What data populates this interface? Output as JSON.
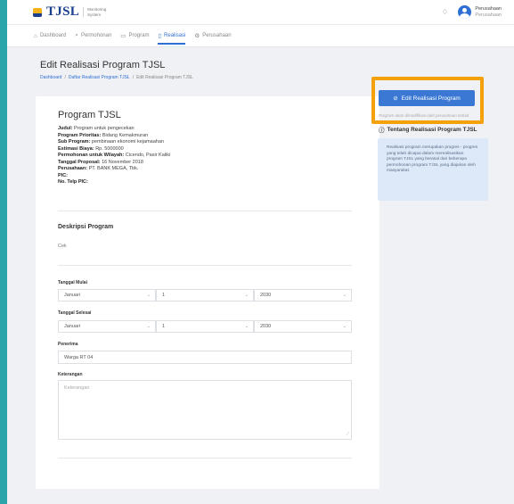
{
  "header": {
    "brand_name": "TJSL",
    "brand_sub": "Monitoring System",
    "user_name": "Perusahaan",
    "user_role": "Perusahaan"
  },
  "nav": [
    {
      "label": "Dashboard",
      "icon": "home-icon",
      "glyph": "⌂"
    },
    {
      "label": "Permohonan",
      "icon": "paperclip-icon",
      "glyph": "⌕"
    },
    {
      "label": "Program",
      "icon": "folder-icon",
      "glyph": "▭"
    },
    {
      "label": "Realisasi",
      "icon": "document-icon",
      "glyph": "▯",
      "active": true
    },
    {
      "label": "Perusahaan",
      "icon": "settings-icon",
      "glyph": "⚙"
    }
  ],
  "page": {
    "title": "Edit Realisasi Program TJSL",
    "breadcrumb": [
      "Dashboard",
      "Daftar Realisasi Program TJSL",
      "Edit Realisasi Program TJSL"
    ]
  },
  "program": {
    "title": "Program TJSL",
    "fields": [
      {
        "key": "Judul",
        "value": "Program untuk pengecekan"
      },
      {
        "key": "Program Prioritas",
        "value": "Bidang Kemakmuran"
      },
      {
        "key": "Sub Program",
        "value": "pembinaan ekonomi kejamaahan"
      },
      {
        "key": "Estimasi Biaya",
        "value": "Rp. 5000000"
      },
      {
        "key": "Permohonan untuk Wilayah",
        "value": "Cicendo, Pasir Kaliki"
      },
      {
        "key": "Tanggal Proposal",
        "value": "16 November 2018"
      },
      {
        "key": "Perusahaan",
        "value": "PT. BANK MEGA, Tbk."
      },
      {
        "key": "PIC",
        "value": ""
      },
      {
        "key": "No. Telp PIC",
        "value": ""
      }
    ]
  },
  "description": {
    "title": "Deskripsi Program",
    "text": "Cek"
  },
  "form": {
    "start_label": "Tanggal Mulai",
    "start_month": "Januari",
    "start_day": "1",
    "start_year": "2030",
    "end_label": "Tanggal Selesai",
    "end_month": "Januari",
    "end_day": "1",
    "end_year": "2030",
    "receiver_label": "Penerima",
    "receiver_value": "Warga RT 04",
    "note_label": "Keterangan",
    "note_placeholder": "Keterangan"
  },
  "sidebar": {
    "edit_button": "Edit Realisasi Program",
    "edit_note": "Program akan dimodifikasi oleh perusahaan terkait",
    "about_title": "Tentang Realisasi Program TJSL",
    "about_text": "Realisasi program merupakan progres - progres yang telah dicapai dalam merealisasikan program TJSL yang berasal dari beberapa permohonan program TJSL yang diajukan oleh masyarakat."
  },
  "colors": {
    "accent": "#3a78d4",
    "highlight": "#f5a10b",
    "info_box": "#dde8f8",
    "background": "#2aa6a8"
  }
}
